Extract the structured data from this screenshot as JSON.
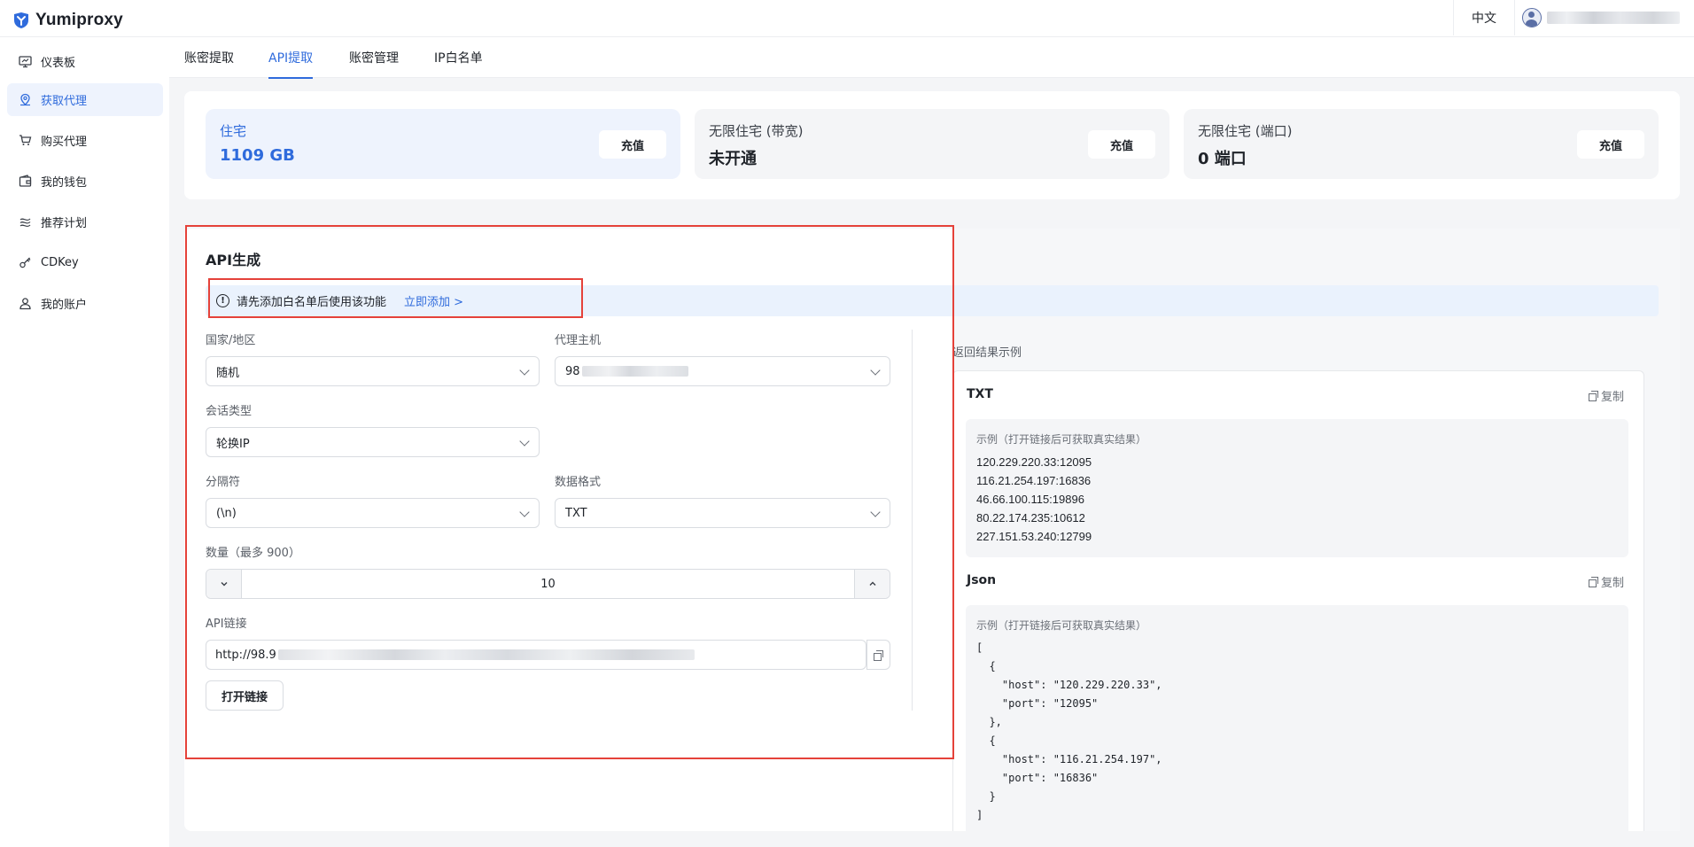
{
  "app": {
    "brand": "Yumiproxy",
    "language": "中文"
  },
  "sidebar": {
    "items": [
      {
        "label": "仪表板",
        "icon": "dashboard-icon"
      },
      {
        "label": "获取代理",
        "icon": "location-icon",
        "active": true
      },
      {
        "label": "购买代理",
        "icon": "cart-icon"
      },
      {
        "label": "我的钱包",
        "icon": "wallet-icon"
      },
      {
        "label": "推荐计划",
        "icon": "referral-icon"
      },
      {
        "label": "CDKey",
        "icon": "key-icon"
      },
      {
        "label": "我的账户",
        "icon": "user-icon"
      }
    ]
  },
  "tabs": [
    {
      "label": "账密提取"
    },
    {
      "label": "API提取",
      "active": true
    },
    {
      "label": "账密管理"
    },
    {
      "label": "IP白名单"
    }
  ],
  "balances": [
    {
      "title": "住宅",
      "value": "1109 GB",
      "button": "充值"
    },
    {
      "title": "无限住宅 (带宽)",
      "value": "未开通",
      "button": "充值"
    },
    {
      "title": "无限住宅 (端口)",
      "value": "0 端口",
      "button": "充值"
    }
  ],
  "api": {
    "title": "API生成",
    "notice": {
      "text": "请先添加白名单后使用该功能",
      "link": "立即添加 >"
    },
    "fields": {
      "country": {
        "label": "国家/地区",
        "value": "随机"
      },
      "host": {
        "label": "代理主机",
        "value": "98"
      },
      "session": {
        "label": "会话类型",
        "value": "轮换IP"
      },
      "separator": {
        "label": "分隔符",
        "value": "(\\n)"
      },
      "format": {
        "label": "数据格式",
        "value": "TXT"
      },
      "quantity": {
        "label": "数量（最多 900）",
        "value": "10"
      },
      "link": {
        "label": "API链接",
        "value": "http://98.9"
      }
    },
    "open_button": "打开链接"
  },
  "examples": {
    "title": "返回结果示例",
    "copy_label": "复制",
    "caption": "示例（打开链接后可获取真实结果）",
    "txt": {
      "heading": "TXT",
      "lines": [
        "120.229.220.33:12095",
        "116.21.254.197:16836",
        "46.66.100.115:19896",
        "80.22.174.235:10612",
        "227.151.53.240:12799"
      ]
    },
    "json": {
      "heading": "Json",
      "lines": [
        "[",
        "  {",
        "    \"host\": \"120.229.220.33\",",
        "    \"port\": \"12095\"",
        "  },",
        "  {",
        "    \"host\": \"116.21.254.197\",",
        "    \"port\": \"16836\"",
        "  }",
        "]"
      ]
    }
  },
  "colors": {
    "accent": "#2f6bdc",
    "highlight_border": "#e5423a",
    "notice_bg": "#eaf2fd"
  }
}
